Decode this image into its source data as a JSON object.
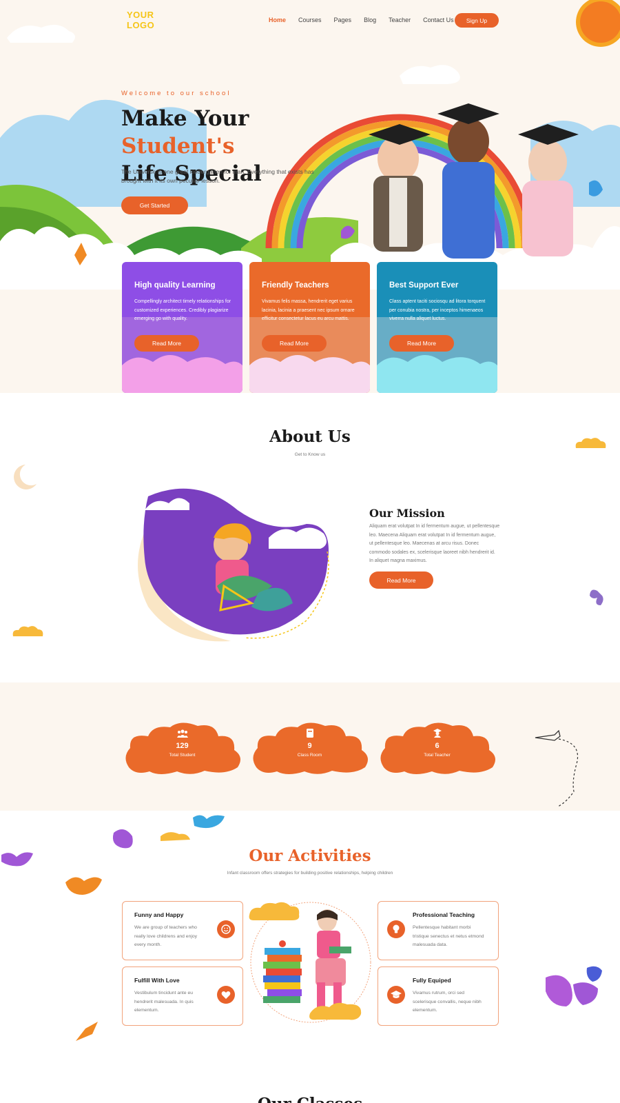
{
  "header": {
    "logo": "YOUR LOGO",
    "nav": [
      {
        "label": "Home",
        "active": true
      },
      {
        "label": "Courses",
        "active": false
      },
      {
        "label": "Pages",
        "active": false
      },
      {
        "label": "Blog",
        "active": false
      },
      {
        "label": "Teacher",
        "active": false
      },
      {
        "label": "Contact Us",
        "active": false
      }
    ],
    "signup_label": "Sign Up"
  },
  "hero": {
    "welcome": "Welcome to our school",
    "title_part1": "Make Your ",
    "title_highlight": "Student's",
    "title_part2": "Life Special",
    "description": "The Universe is one great kindergarten for man. Everything that exists has brought with it its own peculiar lesson.",
    "cta_label": "Get Started"
  },
  "features": [
    {
      "title": "High quality Learning",
      "text": "Compellingly architect timely relationships for customized experiences. Credibly plagiarize emerging go with quality.",
      "button": "Read More",
      "color": "#8e4ee6"
    },
    {
      "title": "Friendly Teachers",
      "text": "Vivamus felis massa, hendrerit eget varius lacinia, lacinia a praesent nec ipsum ornare efficitur consectetur lacus eu arcu mattis.",
      "button": "Read More",
      "color": "#ea6a2a"
    },
    {
      "title": "Best Support Ever",
      "text": "Class aptent taciti sociosqu ad litora torquent per conubia nostra, per inceptos himenaeos viverra nulla aliquet luctus.",
      "button": "Read More",
      "color": "#1a8fb8"
    }
  ],
  "about": {
    "title": "About Us",
    "subtitle": "Get to Know us",
    "mission_title": "Our Mission",
    "mission_text": "Aliquam erat volutpat In id fermentum augue, ut pellentesque leo. Maecena Aliquam erat volutpat In id fermentum augue, ut pellentesque leo. Maecenas at arcu risus. Donec commodo sodales ex, scelerisque laoreet nibh hendrerit id. In aliquet magna maximus.",
    "mission_button": "Read More"
  },
  "stats": [
    {
      "icon": "students-icon",
      "value": "129",
      "label": "Total Student"
    },
    {
      "icon": "book-icon",
      "value": "9",
      "label": "Class Room"
    },
    {
      "icon": "teacher-icon",
      "value": "6",
      "label": "Total Teacher"
    }
  ],
  "activities": {
    "title": "Our Activities",
    "subtitle": "Infant classroom offers strategies for building positive relationships, helping children",
    "items": [
      {
        "title": "Funny and Happy",
        "text": "We are group of teachers who really love childrens and enjoy every month.",
        "icon": "smile-icon"
      },
      {
        "title": "Professional Teaching",
        "text": "Pellentesque habitant morbi tristique senectus et netus etmond malesuada data.",
        "icon": "lightbulb-icon"
      },
      {
        "title": "Fulfill With Love",
        "text": "Vestibulum tincidunt ante eu hendrerit malesuada. In quis elementum.",
        "icon": "heart-icon"
      },
      {
        "title": "Fully Equiped",
        "text": "Vivamus rutrum, orci sed scelerisque convallis, neque nibh elementum.",
        "icon": "graduation-cap-icon"
      }
    ]
  },
  "next_section_title": "Our Classes",
  "colors": {
    "accent": "#e8622a",
    "background": "#fcf6ef",
    "logo": "#f5c518"
  }
}
